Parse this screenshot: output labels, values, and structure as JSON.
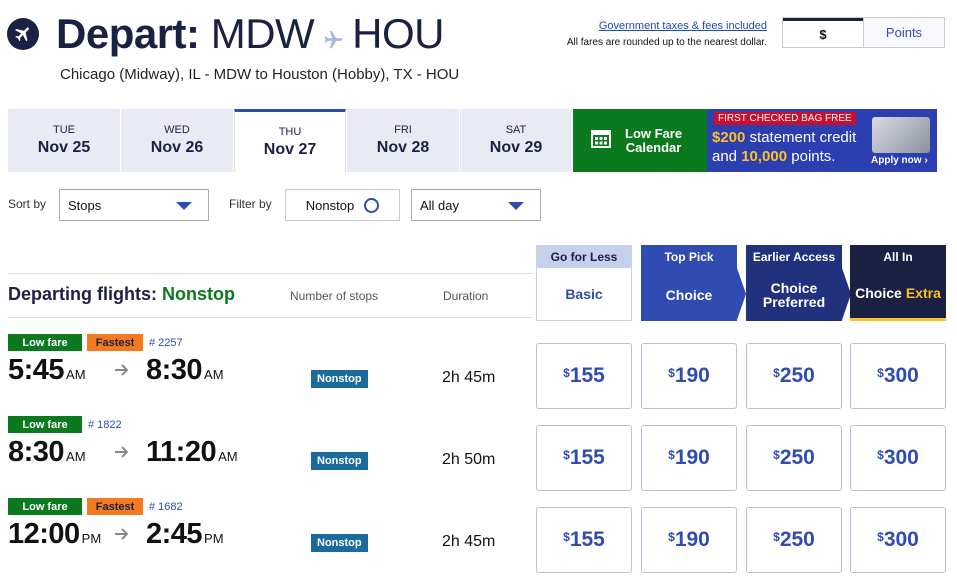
{
  "header": {
    "title_bold": "Depart:",
    "origin": "MDW",
    "destination": "HOU",
    "subtitle": "Chicago (Midway), IL - MDW to Houston (Hobby), TX - HOU",
    "tax_link": "Government taxes & fees included",
    "tax_note": "All fares are rounded up to the nearest dollar.",
    "currency_options": [
      "$",
      "Points"
    ],
    "currency_selected": "$"
  },
  "date_tabs": [
    {
      "dow": "TUE",
      "date": "Nov 25",
      "selected": false
    },
    {
      "dow": "WED",
      "date": "Nov 26",
      "selected": false
    },
    {
      "dow": "THU",
      "date": "Nov 27",
      "selected": true
    },
    {
      "dow": "FRI",
      "date": "Nov 28",
      "selected": false
    },
    {
      "dow": "SAT",
      "date": "Nov 29",
      "selected": false
    }
  ],
  "low_fare_calendar": {
    "line1": "Low Fare",
    "line2": "Calendar"
  },
  "promo": {
    "tag": "FIRST CHECKED BAG FREE",
    "amount1": "$200",
    "text1": " statement credit",
    "text2a": "and ",
    "amount2": "10,000",
    "text2b": " points.",
    "apply": "Apply now"
  },
  "filters": {
    "sort_label": "Sort by",
    "sort_value": "Stops",
    "filter_label": "Filter by",
    "nonstop_label": "Nonstop",
    "time_value": "All day"
  },
  "fare_headers": [
    {
      "top": "Go for Less",
      "main": "Basic",
      "main2": ""
    },
    {
      "top": "Top Pick",
      "main": "Choice",
      "main2": ""
    },
    {
      "top": "Earlier Access",
      "main": "Choice",
      "main2": "Preferred"
    },
    {
      "top": "All In",
      "main": "Choice",
      "main2": "Extra"
    }
  ],
  "columns": {
    "departing_label": "Departing flights: ",
    "departing_filter": "Nonstop",
    "stops": "Number of stops",
    "duration": "Duration"
  },
  "flights": [
    {
      "badges": [
        "Low fare",
        "Fastest"
      ],
      "flight_no": "# 2257",
      "depart": "5:45",
      "depart_ap": "AM",
      "arrive": "8:30",
      "arrive_ap": "AM",
      "stops": "Nonstop",
      "duration": "2h 45m",
      "fares": [
        "155",
        "190",
        "250",
        "300"
      ]
    },
    {
      "badges": [
        "Low fare"
      ],
      "flight_no": "# 1822",
      "depart": "8:30",
      "depart_ap": "AM",
      "arrive": "11:20",
      "arrive_ap": "AM",
      "stops": "Nonstop",
      "duration": "2h 50m",
      "fares": [
        "155",
        "190",
        "250",
        "300"
      ]
    },
    {
      "badges": [
        "Low fare",
        "Fastest"
      ],
      "flight_no": "# 1682",
      "depart": "12:00",
      "depart_ap": "PM",
      "arrive": "2:45",
      "arrive_ap": "PM",
      "stops": "Nonstop",
      "duration": "2h 45m",
      "fares": [
        "155",
        "190",
        "250",
        "300"
      ]
    }
  ],
  "currency_symbol": "$",
  "colors": {
    "navy": "#1a2142",
    "blue": "#304cb2",
    "green": "#0b7a1e",
    "orange": "#f47a20",
    "gold": "#ffbf27"
  }
}
